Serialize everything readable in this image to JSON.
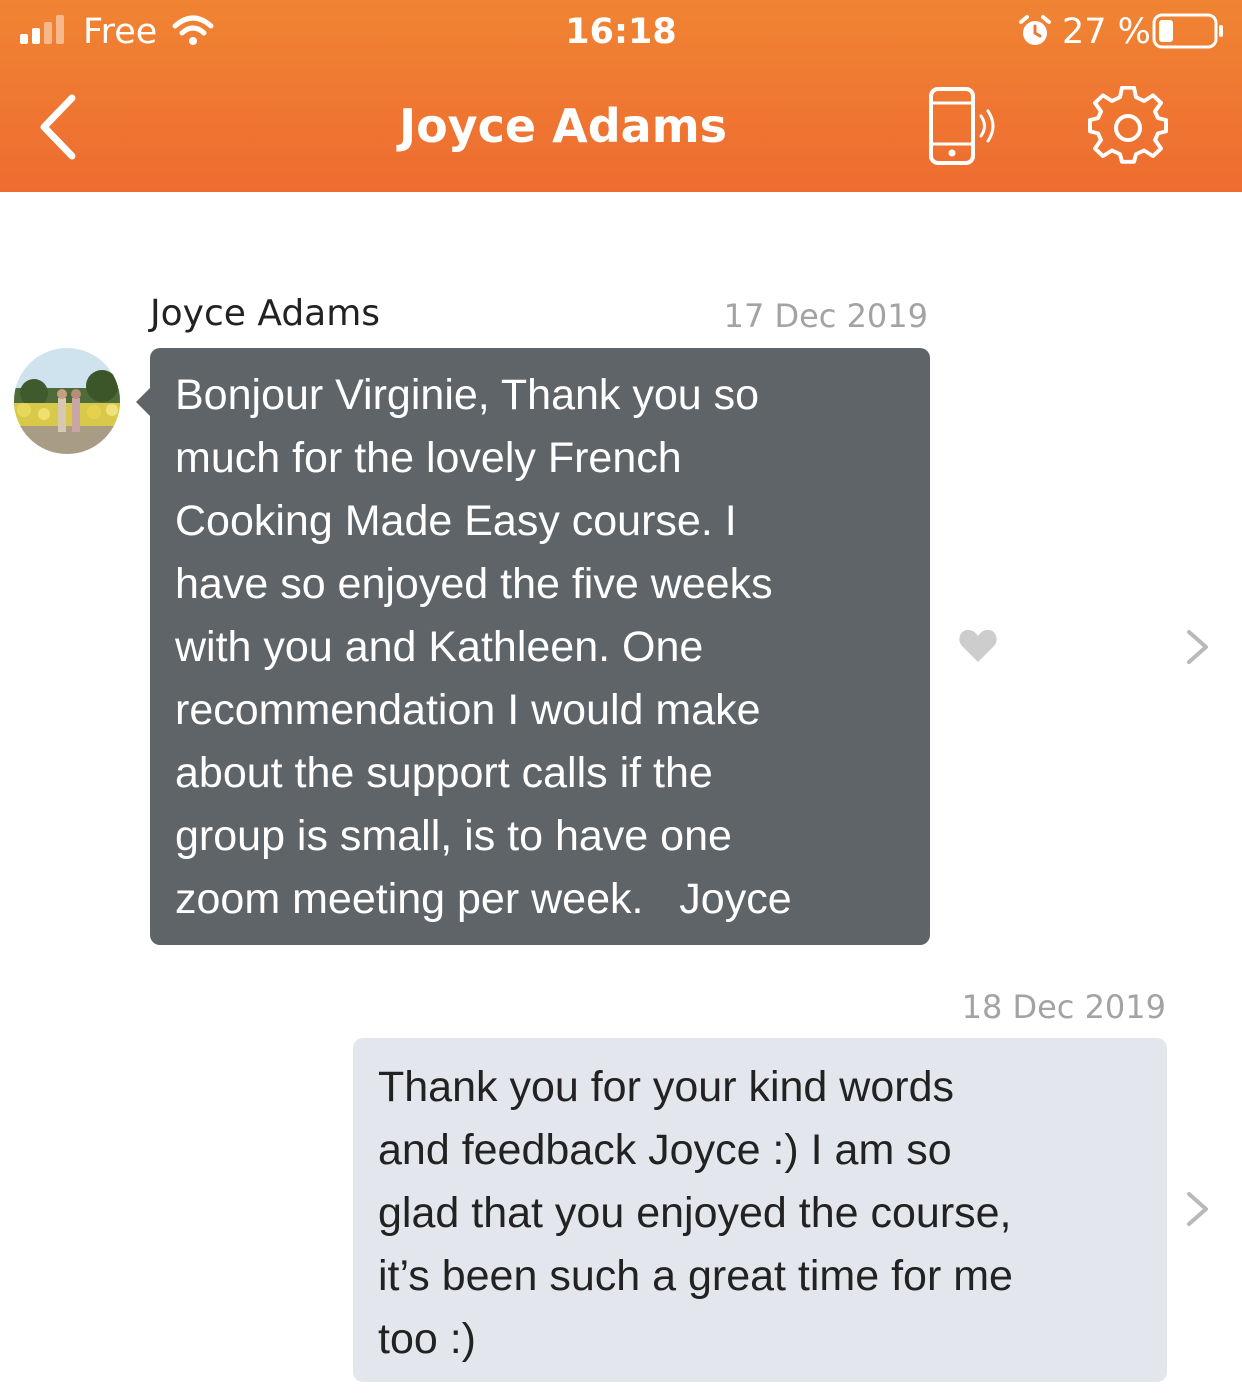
{
  "status_bar": {
    "carrier": "Free",
    "time": "16:18",
    "battery_percent": "27 %",
    "icons": [
      "signal-icon",
      "wifi-icon",
      "alarm-icon",
      "battery-icon"
    ]
  },
  "header": {
    "title": "Joyce Adams",
    "icons": [
      "back-chevron-icon",
      "phone-icon",
      "gear-icon"
    ]
  },
  "colors": {
    "header_orange": "#ef7731",
    "incoming_bubble": "#5f6469",
    "outgoing_bubble": "#e3e7ed",
    "date_gray": "#a3a3a3"
  },
  "messages": [
    {
      "sender": "Joyce Adams",
      "date": "17 Dec 2019",
      "text": "Bonjour Virginie, Thank you so much for the lovely French Cooking Made Easy course. I have so enjoyed the five weeks with you and Kathleen. One recommendation I would make about the support calls if the group is small, is to have one zoom meeting per week.   Joyce",
      "lines": [
        "Bonjour Virginie, Thank you so",
        "much for the lovely French",
        "Cooking Made Easy course. I",
        "have so enjoyed the five weeks",
        "with you and Kathleen. One",
        "recommendation I would make",
        "about the support calls if the",
        "group is small, is to have one",
        "zoom meeting per week.   Joyce"
      ],
      "liked": false
    },
    {
      "date": "18 Dec 2019",
      "text": "Thank you for your kind words and feedback Joyce :) I am so glad that you enjoyed the course, it’s been such a great time for me too :)",
      "lines": [
        "Thank you for your kind words",
        "and feedback Joyce :) I am so",
        "glad that you enjoyed the course,",
        "it’s been such a great time for me",
        "too :)"
      ]
    }
  ]
}
